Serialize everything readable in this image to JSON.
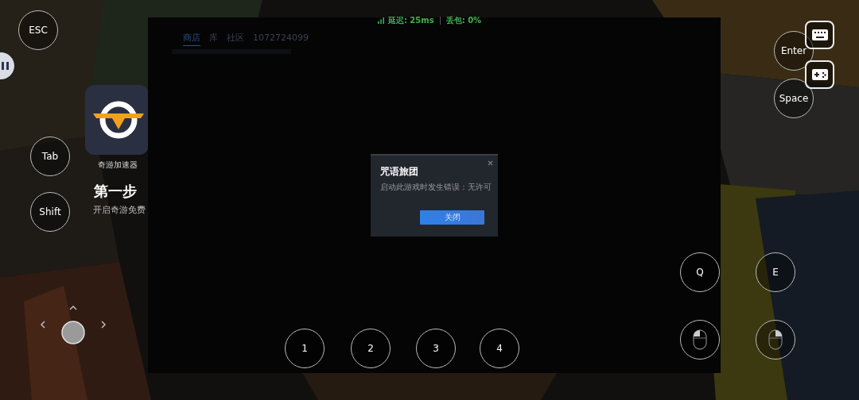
{
  "promo": {
    "app_name": "奇游加速器",
    "heading": "第一步",
    "text": "开启奇游免费"
  },
  "stream_window": {
    "nav_tabs": [
      {
        "label": "商店",
        "selected": true
      },
      {
        "label": "库",
        "selected": false
      },
      {
        "label": "社区",
        "selected": false
      },
      {
        "label": "1072724099",
        "selected": false
      }
    ]
  },
  "network_status": {
    "latency": "延迟: 25ms",
    "packet_loss": "丢包: 0%"
  },
  "dialog": {
    "title": "咒语旅团",
    "message": "启动此游戏时发生错误：无许可",
    "button": "关闭"
  },
  "keys": [
    {
      "kind": "key",
      "label": "ESC"
    },
    {
      "kind": "key",
      "label": "Tab"
    },
    {
      "kind": "key",
      "label": "Shift"
    },
    {
      "kind": "key",
      "label": "Enter"
    },
    {
      "kind": "key",
      "label": "Space"
    },
    {
      "kind": "key",
      "label": "Q"
    },
    {
      "kind": "key",
      "label": "E"
    },
    {
      "kind": "key",
      "label": "1"
    },
    {
      "kind": "key",
      "label": "2"
    },
    {
      "kind": "key",
      "label": "3"
    },
    {
      "kind": "key",
      "label": "4"
    },
    {
      "kind": "mouse-left"
    },
    {
      "kind": "mouse-right"
    }
  ]
}
